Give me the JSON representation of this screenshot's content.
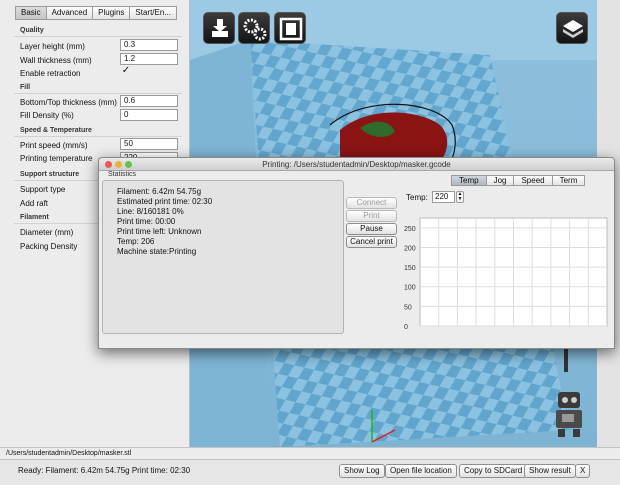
{
  "settings": {
    "tabs": [
      "Basic",
      "Advanced",
      "Plugins",
      "Start/En..."
    ],
    "active_tab": 0,
    "sections": {
      "quality": "Quality",
      "fill": "Fill",
      "speed_temp": "Speed & Temperature",
      "support": "Support structure",
      "filament": "Filament"
    },
    "rows": {
      "layer_height": {
        "label": "Layer height (mm)",
        "value": "0.3"
      },
      "wall_thickness": {
        "label": "Wall thickness (mm)",
        "value": "1.2"
      },
      "enable_retraction": {
        "label": "Enable retraction",
        "checked": "✓"
      },
      "bottom_top": {
        "label": "Bottom/Top thickness (mm)",
        "value": "0.6"
      },
      "fill_density": {
        "label": "Fill Density (%)",
        "value": "0"
      },
      "print_speed": {
        "label": "Print speed (mm/s)",
        "value": "50"
      },
      "printing_temp": {
        "label": "Printing temperature",
        "value": "220"
      },
      "support_type": {
        "label": "Support type"
      },
      "add_raft": {
        "label": "Add raft"
      },
      "diameter": {
        "label": "Diameter (mm)"
      },
      "packing_density": {
        "label": "Packing Density"
      }
    }
  },
  "viewport": {
    "toolbar_icons": [
      "load-model-icon",
      "settings-gears-icon",
      "print-icon"
    ],
    "view_mode_icon": "view-mode-icon",
    "colors": {
      "background": "#86bad9",
      "platform": "#5ea3cc",
      "model": "#8a1414"
    }
  },
  "print_window": {
    "title": "Printing: /Users/studentadmin/Desktop/masker.gcode",
    "stats_label": "Statistics",
    "stats": [
      "Filament: 6.42m 54.75g",
      "Estimated print time: 02:30",
      "Line: 8/160181 0%",
      "Print time: 00:00",
      "Print time left: Unknown",
      "Temp: 206",
      "Machine state:Printing"
    ],
    "buttons": {
      "connect": "Connect",
      "print": "Print",
      "pause": "Pause",
      "cancel": "Cancel print"
    },
    "graph_tabs": [
      "Temp",
      "Jog",
      "Speed",
      "Term"
    ],
    "active_graph_tab": 0,
    "temp_label": "Temp:",
    "temp_value": "220",
    "graph_ticks": [
      "250",
      "200",
      "150",
      "100",
      "50",
      "0"
    ],
    "graph_range": [
      0,
      275
    ],
    "graph_grid": true
  },
  "status_bar": {
    "path": "/Users/studentadmin/Desktop/masker.stl",
    "text": "Ready: Filament: 6.42m 54.75g Print time: 02:30",
    "buttons": {
      "show_log": "Show Log",
      "open_location": "Open file location",
      "copy_sd": "Copy to SDCard",
      "show_result": "Show result",
      "close": "X"
    }
  }
}
